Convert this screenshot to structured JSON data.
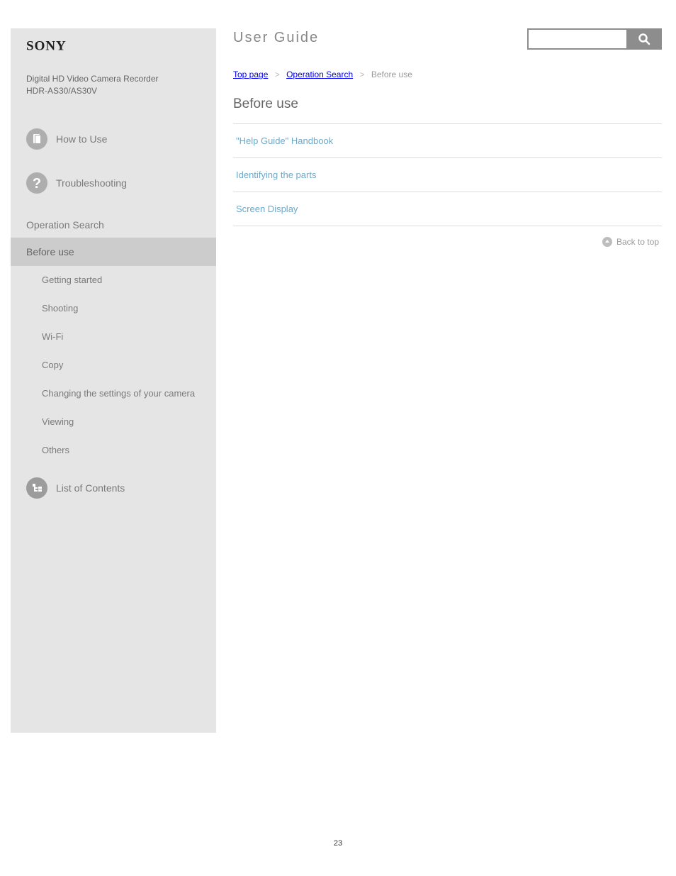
{
  "sidebar": {
    "brand": "SONY",
    "product_line1": "Digital HD Video Camera Recorder",
    "product_line2": "HDR-AS30/AS30V",
    "nav": {
      "howto": "How to Use",
      "trouble": "Troubleshooting",
      "operation_header": "Operation Search",
      "before_use": "Before use",
      "getting_started": "Getting started",
      "shooting": "Shooting",
      "wifi": "Wi-Fi",
      "copy": "Copy",
      "settings": "Changing the settings of your camera",
      "viewing": "Viewing",
      "others": "Others",
      "contents": "List of Contents"
    }
  },
  "header": {
    "title": "User Guide"
  },
  "breadcrumb": {
    "b0": "Top page",
    "b1": "Operation Search",
    "b2": "Before use"
  },
  "page_title": "Before use",
  "links": {
    "l0": "\"Help Guide\" Handbook",
    "l1": "Identifying the parts",
    "l2": "Screen Display"
  },
  "totop": "Back to top",
  "pagenum": "23"
}
